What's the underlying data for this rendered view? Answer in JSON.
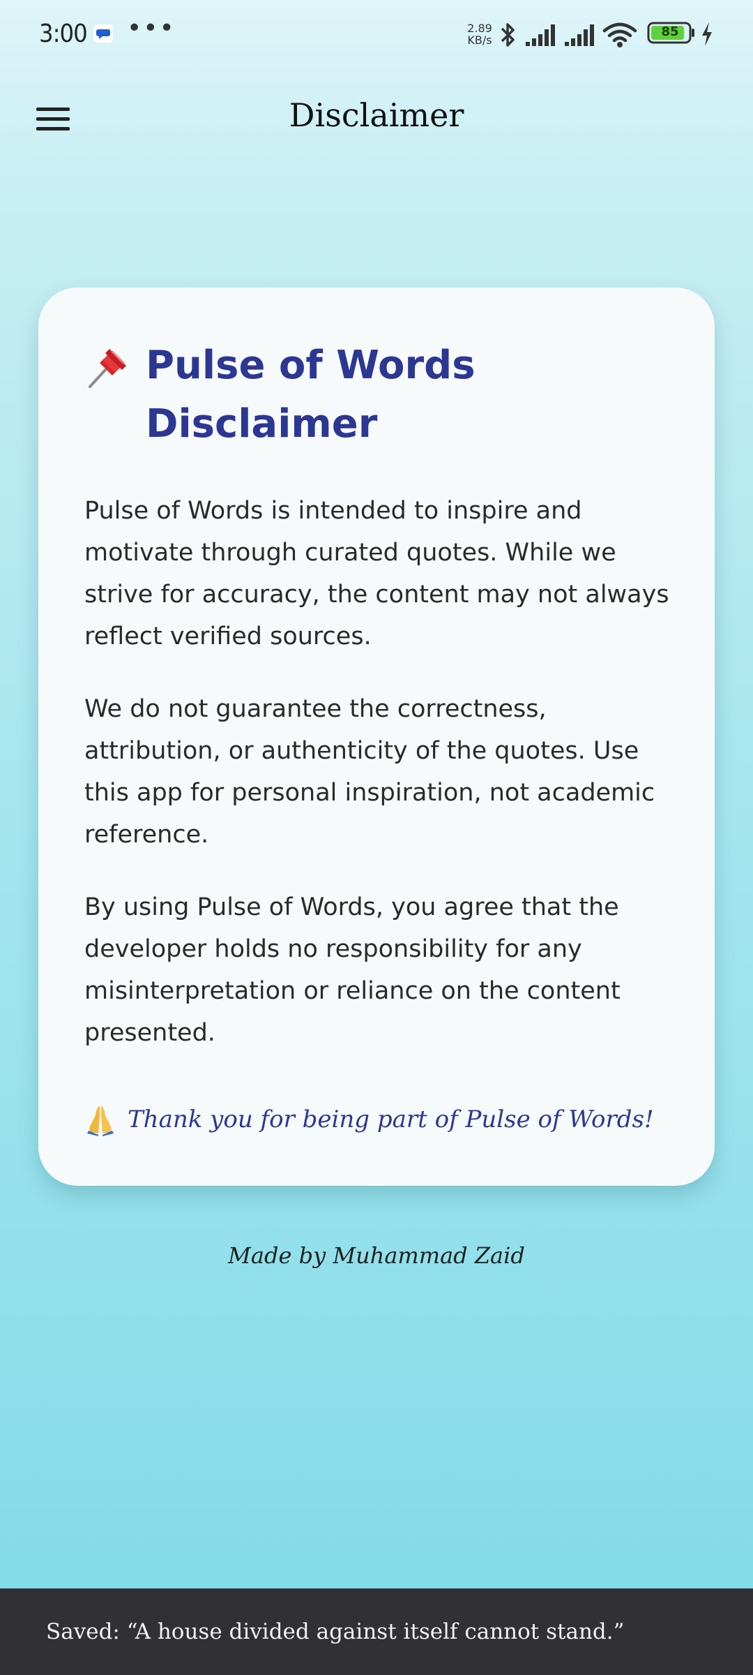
{
  "status_bar": {
    "time": "3:00",
    "more": "•••",
    "net_speed_value": "2.89",
    "net_speed_unit": "KB/s",
    "battery": "85",
    "icons": [
      "message-icon",
      "bluetooth-icon",
      "signal-icon",
      "signal-icon",
      "wifi-icon",
      "battery-icon",
      "charging-icon"
    ]
  },
  "app_bar": {
    "title": "Disclaimer",
    "menu_icon": "hamburger-menu-icon"
  },
  "card": {
    "heading_icon": "pushpin-icon",
    "heading": "Pulse of Words\nDisclaimer",
    "paragraphs": [
      "Pulse of Words is intended to inspire and motivate through curated quotes. While we strive for accuracy, the content may not always reflect verified sources.",
      "We do not guarantee the correctness, attribution, or authenticity of the quotes. Use this app for personal inspiration, not academic reference.",
      "By using Pulse of Words, you agree that the developer holds no responsibility for any misinterpretation or reliance on the content presented."
    ],
    "thanks_icon": "praying-hands-icon",
    "thanks": "Thank you for being part of Pulse of Words!"
  },
  "credit": "Made by Muhammad Zaid",
  "snackbar": {
    "text": "Saved: “A house divided against itself cannot stand.”"
  },
  "colors": {
    "accent": "#2c3794",
    "snackbar_bg": "#303035",
    "battery_fill": "#5fd13a"
  }
}
